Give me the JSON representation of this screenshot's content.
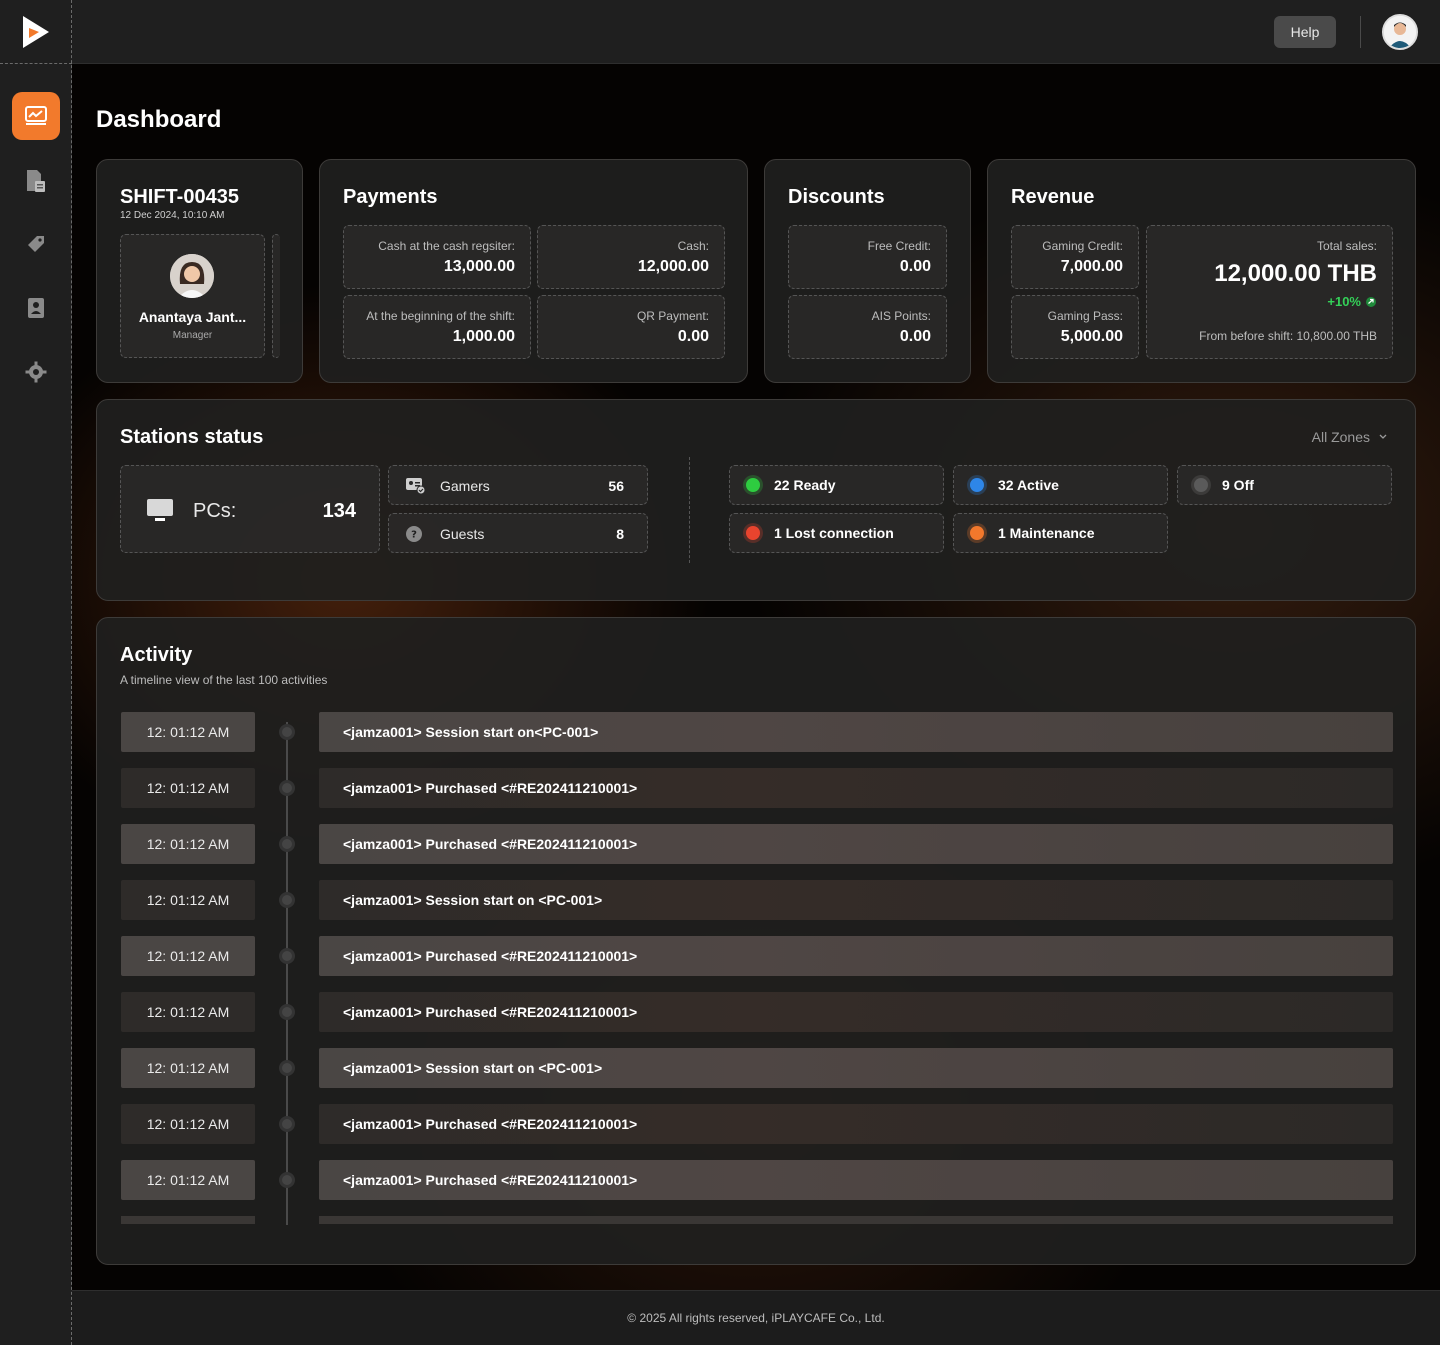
{
  "topbar": {
    "help_label": "Help"
  },
  "page": {
    "title": "Dashboard"
  },
  "shift": {
    "id": "SHIFT-00435",
    "datetime": "12 Dec 2024, 10:10 AM",
    "staff_name": "Anantaya Jant...",
    "staff_role": "Manager"
  },
  "payments": {
    "title": "Payments",
    "items": [
      {
        "label": "Cash at the cash regsiter:",
        "value": "13,000.00"
      },
      {
        "label": "Cash:",
        "value": "12,000.00"
      },
      {
        "label": "At the beginning of the shift:",
        "value": "1,000.00"
      },
      {
        "label": "QR Payment:",
        "value": "0.00"
      }
    ]
  },
  "discounts": {
    "title": "Discounts",
    "items": [
      {
        "label": "Free Credit:",
        "value": "0.00"
      },
      {
        "label": "AIS Points:",
        "value": "0.00"
      }
    ]
  },
  "revenue": {
    "title": "Revenue",
    "gaming_credit_label": "Gaming Credit:",
    "gaming_credit_value": "7,000.00",
    "gaming_pass_label": "Gaming Pass:",
    "gaming_pass_value": "5,000.00",
    "total_label": "Total sales:",
    "total_value": "12,000.00 THB",
    "change": "+10%",
    "before_shift": "From before shift: 10,800.00 THB",
    "positive_color": "#34d058"
  },
  "stations": {
    "title": "Stations status",
    "zone_filter": "All Zones",
    "pcs_label": "PCs:",
    "pcs_count": "134",
    "gamers_label": "Gamers",
    "gamers_count": "56",
    "guests_label": "Guests",
    "guests_count": "8",
    "statuses": [
      {
        "label": "22 Ready",
        "color": "#2ecc40"
      },
      {
        "label": "32 Active",
        "color": "#2e86e8"
      },
      {
        "label": "9 Off",
        "color": "#5a5a5a"
      },
      {
        "label": "1 Lost connection",
        "color": "#e8442e"
      },
      {
        "label": "1 Maintenance",
        "color": "#f2782c"
      }
    ]
  },
  "activity": {
    "title": "Activity",
    "subtitle": "A timeline view of the last 100 activities",
    "rows": [
      {
        "time": "12: 01:12 AM",
        "text": "<jamza001> Session start on<PC-001>"
      },
      {
        "time": "12: 01:12 AM",
        "text": "<jamza001> Purchased <#RE202411210001>"
      },
      {
        "time": "12: 01:12 AM",
        "text": "<jamza001> Purchased <#RE202411210001>"
      },
      {
        "time": "12: 01:12 AM",
        "text": "<jamza001> Session start on <PC-001>"
      },
      {
        "time": "12: 01:12 AM",
        "text": "<jamza001> Purchased <#RE202411210001>"
      },
      {
        "time": "12: 01:12 AM",
        "text": "<jamza001> Purchased <#RE202411210001>"
      },
      {
        "time": "12: 01:12 AM",
        "text": "<jamza001> Session start on <PC-001>"
      },
      {
        "time": "12: 01:12 AM",
        "text": "<jamza001> Purchased <#RE202411210001>"
      },
      {
        "time": "12: 01:12 AM",
        "text": "<jamza001> Purchased <#RE202411210001>"
      }
    ]
  },
  "footer": {
    "text": "© 2025 All rights reserved, iPLAYCAFE Co., Ltd."
  },
  "icons": {
    "sidebar": [
      "dashboard-chart-icon",
      "report-document-icon",
      "ticket-tag-icon",
      "user-card-icon",
      "settings-gear-icon"
    ]
  },
  "colors": {
    "accent": "#f27a2c"
  }
}
